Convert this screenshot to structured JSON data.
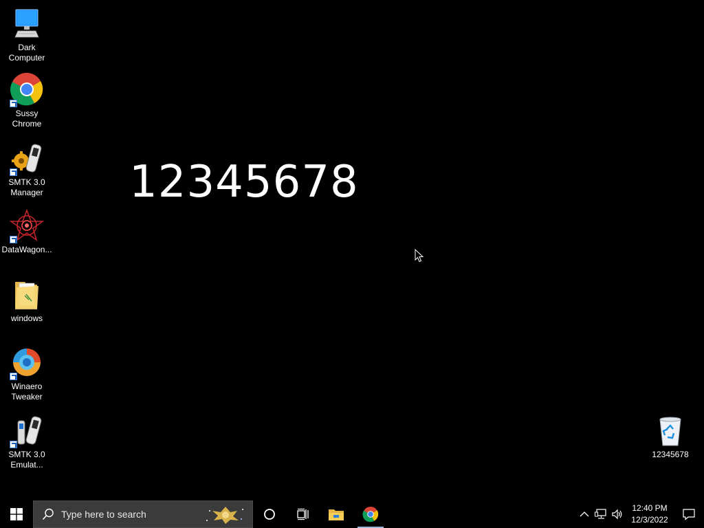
{
  "desktop": {
    "icons": [
      {
        "label": "Dark\nComputer"
      },
      {
        "label": "Sussy\nChrome"
      },
      {
        "label": "SMTK 3.0\nManager"
      },
      {
        "label": "DataWagon..."
      },
      {
        "label": "windows"
      },
      {
        "label": "Winaero\nTweaker"
      },
      {
        "label": "SMTK 3.0\nEmulat..."
      },
      {
        "label": "12345678"
      }
    ],
    "big_text": "12345678"
  },
  "taskbar": {
    "search_placeholder": "Type here to search",
    "clock_time": "12:40 PM",
    "clock_date": "12/3/2022",
    "icons": [
      "windows-start-icon",
      "search-icon",
      "cortana-icon",
      "task-view-icon",
      "file-explorer-icon",
      "chrome-icon",
      "show-hidden-icons-icon",
      "network-icon",
      "volume-icon",
      "action-center-icon"
    ]
  },
  "colors": {
    "desktop_bg": "#000000",
    "taskbar_bg": "#000000",
    "search_bg": "#3b3b3b"
  }
}
